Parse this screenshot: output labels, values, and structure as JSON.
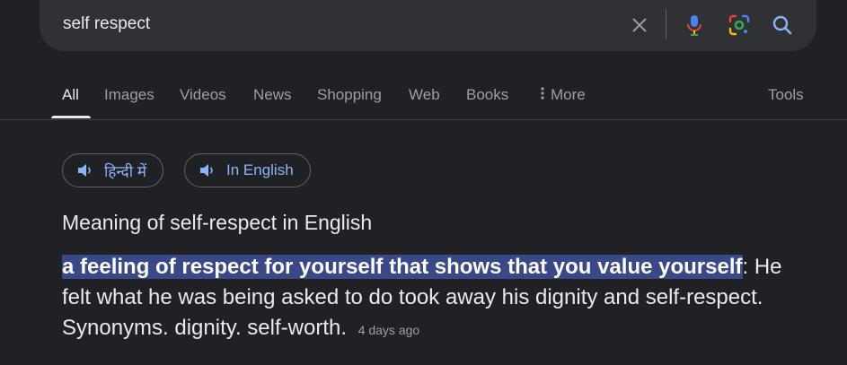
{
  "search": {
    "query": "self respect"
  },
  "tabs": [
    {
      "label": "All"
    },
    {
      "label": "Images"
    },
    {
      "label": "Videos"
    },
    {
      "label": "News"
    },
    {
      "label": "Shopping"
    },
    {
      "label": "Web"
    },
    {
      "label": "Books"
    },
    {
      "label": "More"
    }
  ],
  "tools_label": "Tools",
  "pronunciation": {
    "hindi_label": "हिन्दी में",
    "english_label": "In English"
  },
  "result": {
    "heading": "Meaning of self-respect in English",
    "highlighted_text": "a feeling of respect for yourself that shows that you value yourself",
    "rest_text": ": He felt what he was being asked to do took away his dignity and self-respect. Synonyms. dignity. self-worth.",
    "age": "4 days ago"
  },
  "colors": {
    "background": "#202124",
    "searchbar": "#303134",
    "link": "#8ab4f8",
    "highlight": "#394887"
  },
  "icons": [
    "close-icon",
    "mic-icon",
    "lens-icon",
    "search-icon",
    "more-dots-icon",
    "speaker-icon"
  ]
}
